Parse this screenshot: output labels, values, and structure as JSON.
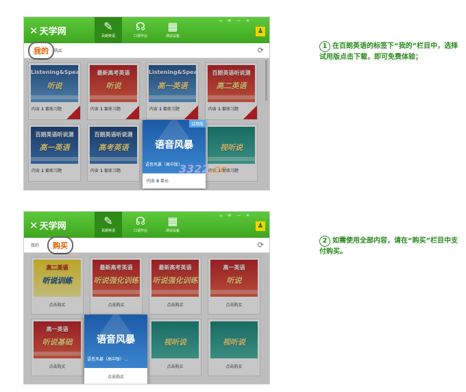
{
  "app": {
    "logo_text": "天学网",
    "window_controls": "▫ ✉ — ✕"
  },
  "nav": [
    {
      "label": "百朗英语"
    },
    {
      "label": "口语作业"
    },
    {
      "label": "测试设备"
    }
  ],
  "tabs": {
    "mine": "我的",
    "buy": "购买"
  },
  "window1": {
    "cards": [
      {
        "title": "Listening&Speaking",
        "sub": "听说",
        "meta_prefix": "内含",
        "meta_count": "1",
        "meta_suffix": "套练习题"
      },
      {
        "title": "最新高考英语",
        "sub": "听说",
        "meta_prefix": "内含",
        "meta_count": "1",
        "meta_suffix": "套练习题"
      },
      {
        "title": "Listening&Speaking",
        "sub": "高一英语",
        "meta_prefix": "内含",
        "meta_count": "1",
        "meta_suffix": "套练习题"
      },
      {
        "title": "百朗英语听说测",
        "sub": "高二英语",
        "meta_prefix": "内含",
        "meta_count": "1",
        "meta_suffix": "套练习题"
      },
      {
        "title": "百朗英语听说测",
        "sub": "高一英语",
        "meta_prefix": "内含",
        "meta_count": "1",
        "meta_suffix": "套练习题"
      },
      {
        "title": "百朗英语听说测",
        "sub": "高考英语",
        "meta_prefix": "内含",
        "meta_count": "1",
        "meta_suffix": "套练习题"
      },
      {
        "title": "",
        "sub": "视听说",
        "meta_prefix": "内含",
        "meta_count": "1",
        "meta_suffix": "套练习题"
      }
    ],
    "featured": {
      "badge": "试用版",
      "big": "语音风暴",
      "name": "语音风暴（高中版）",
      "meta_prefix": "内含",
      "meta_count": "6",
      "meta_suffix": "单元"
    }
  },
  "window2": {
    "cards": [
      {
        "title": "高二英语",
        "sub": "听说训练",
        "buy": "点击购买"
      },
      {
        "title": "最新高考英语",
        "sub": "听说强化训练",
        "buy": "点击购买"
      },
      {
        "title": "最新高考英语",
        "sub": "听说强化训练",
        "buy": "点击购买"
      },
      {
        "title": "高一英语",
        "sub": "听说",
        "buy": "点击购买"
      },
      {
        "title": "高一英语",
        "sub": "听说基础",
        "buy": "点击购买"
      },
      {
        "title": "",
        "sub": "视听说",
        "buy": "点击购买"
      },
      {
        "title": "",
        "sub": "视听说",
        "buy": "点击购买"
      }
    ],
    "featured": {
      "big": "语音风暴",
      "name": "语音风暴（高中版）…",
      "buy": "点击购买"
    }
  },
  "watermark": {
    "main": "3322",
    "dot": ".cc"
  },
  "instructions": [
    {
      "num": "1",
      "text": "在百朗英语的标签下“我的”栏目中，选择试用版点击下载，即可免费体验；"
    },
    {
      "num": "2",
      "text": "如需使用全部内容，请在“购买”栏目中支付购买。"
    }
  ],
  "colors": {
    "brand_green": "#3ea61f",
    "accent_orange": "#e55c00",
    "instruction_green": "#2a8a1d"
  }
}
